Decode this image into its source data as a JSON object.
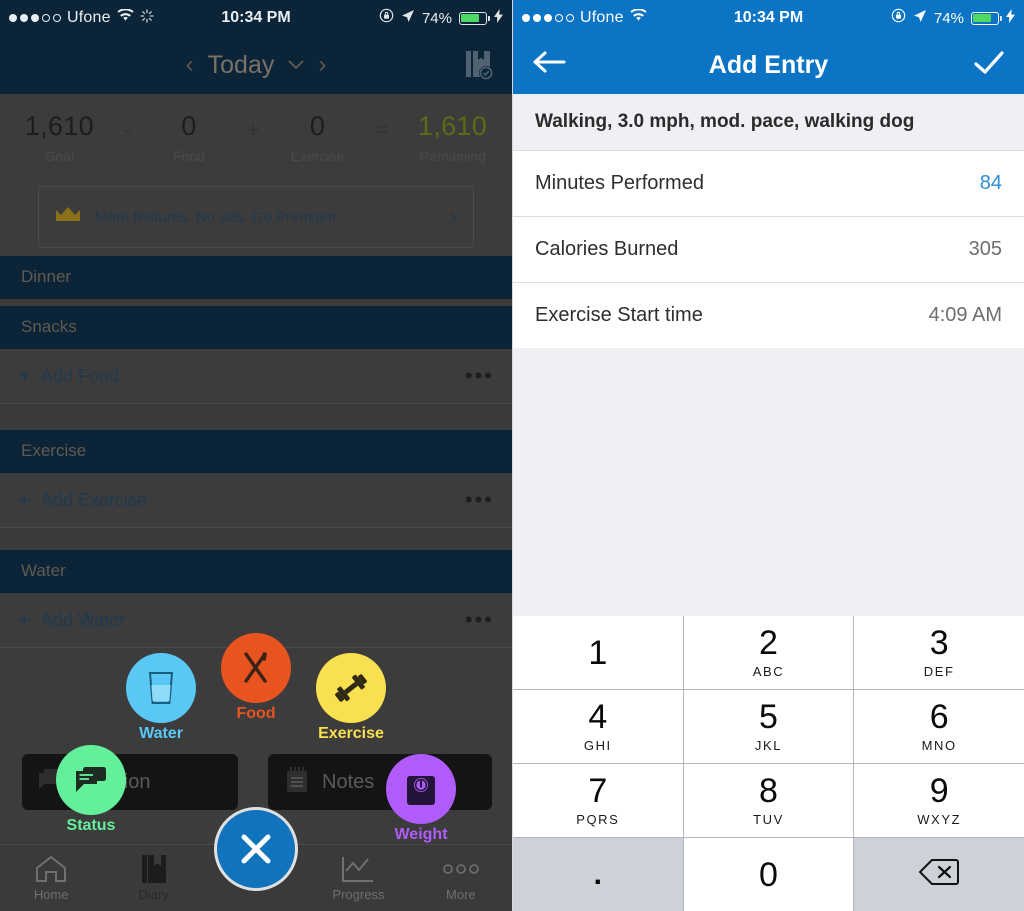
{
  "left_screen": {
    "status_bar": {
      "signal_dots_filled": 3,
      "signal_dots_total": 5,
      "carrier": "Ufone",
      "wifi_icon": "wifi-icon",
      "activity_icon": "activity-spinner-icon",
      "time": "10:34 PM",
      "orientation_lock_icon": "rotation-lock-icon",
      "location_icon": "location-arrow-icon",
      "battery_percent": "74%",
      "battery_fill": 74,
      "charging_icon": "lightning-bolt-icon"
    },
    "nav": {
      "prev_label": "‹",
      "date_label": "Today",
      "caret": "⌄",
      "next_label": "›",
      "diary_icon": "diary-check-icon"
    },
    "summary": {
      "goal_value": "1,610",
      "goal_label": "Goal",
      "op_minus": "-",
      "food_value": "0",
      "food_label": "Food",
      "op_plus": "+",
      "exercise_value": "0",
      "exercise_label": "Exercise",
      "op_equals": "=",
      "remaining_value": "1,610",
      "remaining_label": "Remaining",
      "remaining_color": "#5e6b16"
    },
    "premium_banner": {
      "icon": "crown-icon",
      "text": "More features. No ads. Go Premium.",
      "chevron": "›"
    },
    "sections": [
      {
        "header": "Dinner"
      },
      {
        "header": "Snacks",
        "add_label": "Add Food",
        "plus": "+",
        "more": "•••"
      },
      {
        "header": "Exercise",
        "add_label": "Add Exercise",
        "plus": "+",
        "more": "•••"
      },
      {
        "header": "Water",
        "add_label": "Add Water",
        "plus": "+",
        "more": "•••"
      }
    ],
    "fab_menu": {
      "items": [
        {
          "label": "Water",
          "icon": "water-glass-icon",
          "color": "#5ac8f5"
        },
        {
          "label": "Food",
          "icon": "fork-knife-icon",
          "color": "#e8541f"
        },
        {
          "label": "Exercise",
          "icon": "dumbbell-icon",
          "color": "#f8e04e"
        },
        {
          "label": "Status",
          "icon": "chat-bubble-icon",
          "color": "#64f09a"
        },
        {
          "label": "Weight",
          "icon": "scale-icon",
          "color": "#b05cfb"
        }
      ],
      "dark_bars": [
        {
          "label": "Nutrition",
          "icon": "chat-bubble-icon"
        },
        {
          "label": "Notes",
          "icon": "notepad-icon"
        }
      ],
      "close_label": "✕",
      "close_color": "#1273bd"
    },
    "tab_bar": {
      "items": [
        {
          "label": "Home",
          "icon": "home-icon",
          "active": false
        },
        {
          "label": "Diary",
          "icon": "diary-icon",
          "active": true
        },
        {
          "label": "Progress",
          "icon": "progress-chart-icon",
          "active": false
        },
        {
          "label": "More",
          "icon": "more-dots-icon",
          "active": false
        }
      ]
    }
  },
  "right_screen": {
    "status_bar": {
      "signal_dots_filled": 3,
      "signal_dots_total": 5,
      "carrier": "Ufone",
      "wifi_icon": "wifi-icon",
      "time": "10:34 PM",
      "orientation_lock_icon": "rotation-lock-icon",
      "location_icon": "location-arrow-icon",
      "battery_percent": "74%",
      "battery_fill": 74,
      "charging_icon": "lightning-bolt-icon"
    },
    "nav": {
      "back_icon": "back-arrow-icon",
      "title": "Add Entry",
      "confirm_icon": "checkmark-icon",
      "bar_color": "#0b74c4"
    },
    "exercise_title": "Walking, 3.0 mph, mod. pace, walking dog",
    "fields": [
      {
        "label": "Minutes Performed",
        "value": "84",
        "active": true
      },
      {
        "label": "Calories Burned",
        "value": "305",
        "active": false
      },
      {
        "label": "Exercise Start time",
        "value": "4:09 AM",
        "active": false
      }
    ],
    "keypad": {
      "keys": [
        {
          "num": "1",
          "sub": "",
          "gray": false
        },
        {
          "num": "2",
          "sub": "ABC",
          "gray": false
        },
        {
          "num": "3",
          "sub": "DEF",
          "gray": false
        },
        {
          "num": "4",
          "sub": "GHI",
          "gray": false
        },
        {
          "num": "5",
          "sub": "JKL",
          "gray": false
        },
        {
          "num": "6",
          "sub": "MNO",
          "gray": false
        },
        {
          "num": "7",
          "sub": "PQRS",
          "gray": false
        },
        {
          "num": "8",
          "sub": "TUV",
          "gray": false
        },
        {
          "num": "9",
          "sub": "WXYZ",
          "gray": false
        },
        {
          "num": ".",
          "sub": "",
          "gray": true
        },
        {
          "num": "0",
          "sub": "",
          "gray": false
        },
        {
          "num": "",
          "sub": "",
          "gray": true,
          "icon": "backspace-icon"
        }
      ]
    }
  }
}
